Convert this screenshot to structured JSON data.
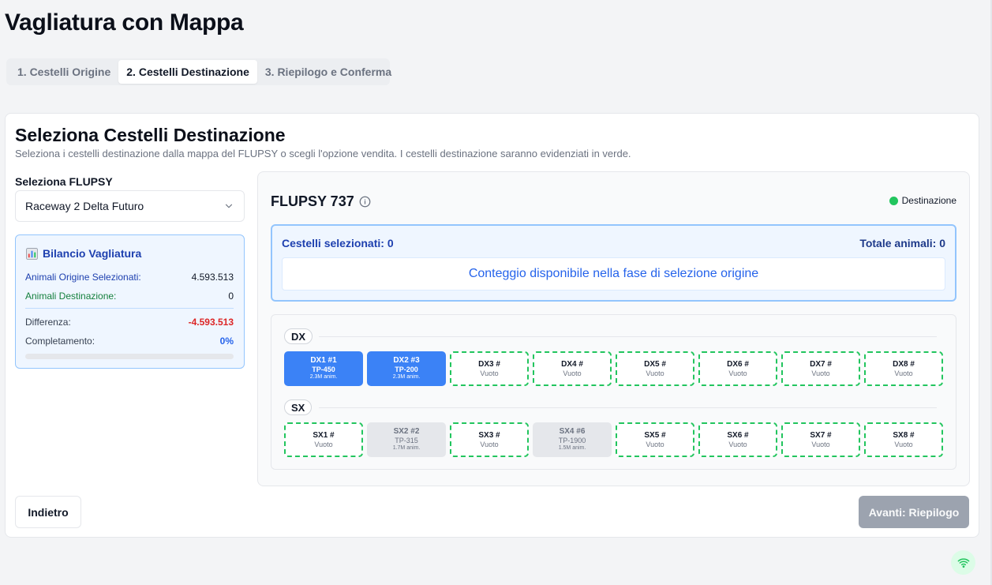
{
  "page": {
    "title": "Vagliatura con Mappa"
  },
  "tabs": [
    {
      "label": "1. Cestelli Origine",
      "active": false
    },
    {
      "label": "2. Cestelli Destinazione",
      "active": true
    },
    {
      "label": "3. Riepilogo e Conferma",
      "active": false
    }
  ],
  "card": {
    "title": "Seleziona Cestelli Destinazione",
    "description": "Seleziona i cestelli destinazione dalla mappa del FLUPSY o scegli l'opzione vendita. I cestelli destinazione saranno evidenziati in verde."
  },
  "flupsy_select": {
    "label": "Seleziona FLUPSY",
    "value": "Raceway 2 Delta Futuro",
    "icon": "chevron-down-icon"
  },
  "balance": {
    "icon": "bar-chart-icon",
    "title": "Bilancio Vagliatura",
    "origin_label": "Animali Origine Selezionati:",
    "origin_value": "4.593.513",
    "dest_label": "Animali Destinazione:",
    "dest_value": "0",
    "diff_label": "Differenza:",
    "diff_value": "-4.593.513",
    "completion_label": "Completamento:",
    "completion_value": "0%",
    "completion_fraction": 0
  },
  "map": {
    "title": "FLUPSY 737",
    "legend_label": "Destinazione",
    "legend_color": "#22c55e",
    "selected_label": "Cestelli selezionati: 0",
    "total_label": "Totale animali: 0",
    "note": "Conteggio disponibile nella fase di selezione origine",
    "rows": [
      {
        "label": "DX",
        "baskets": [
          {
            "state": "selected",
            "name": "DX1 #1",
            "sub": "TP-450",
            "tiny": "2.3M anim."
          },
          {
            "state": "selected",
            "name": "DX2 #3",
            "sub": "TP-200",
            "tiny": "2.3M anim."
          },
          {
            "state": "empty",
            "name": "DX3 #",
            "sub": "Vuoto"
          },
          {
            "state": "empty",
            "name": "DX4 #",
            "sub": "Vuoto"
          },
          {
            "state": "empty",
            "name": "DX5 #",
            "sub": "Vuoto"
          },
          {
            "state": "empty",
            "name": "DX6 #",
            "sub": "Vuoto"
          },
          {
            "state": "empty",
            "name": "DX7 #",
            "sub": "Vuoto"
          },
          {
            "state": "empty",
            "name": "DX8 #",
            "sub": "Vuoto"
          }
        ]
      },
      {
        "label": "SX",
        "baskets": [
          {
            "state": "empty",
            "name": "SX1 #",
            "sub": "Vuoto"
          },
          {
            "state": "occupied",
            "name": "SX2 #2",
            "sub": "TP-315",
            "tiny": "1.7M anim."
          },
          {
            "state": "empty",
            "name": "SX3 #",
            "sub": "Vuoto"
          },
          {
            "state": "occupied",
            "name": "SX4 #6",
            "sub": "TP-1900",
            "tiny": "1.5M anim."
          },
          {
            "state": "empty",
            "name": "SX5 #",
            "sub": "Vuoto"
          },
          {
            "state": "empty",
            "name": "SX6 #",
            "sub": "Vuoto"
          },
          {
            "state": "empty",
            "name": "SX7 #",
            "sub": "Vuoto"
          },
          {
            "state": "empty",
            "name": "SX8 #",
            "sub": "Vuoto"
          }
        ]
      }
    ]
  },
  "buttons": {
    "back": "Indietro",
    "next": "Avanti: Riepilogo"
  },
  "status": {
    "icon": "wifi-icon",
    "color": "#22c55e"
  }
}
